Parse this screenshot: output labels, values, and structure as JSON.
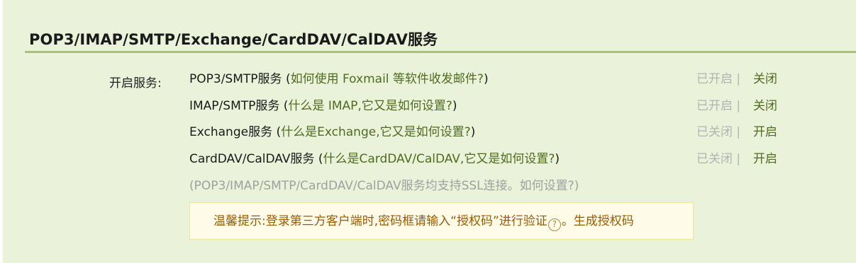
{
  "section": {
    "title": "POP3/IMAP/SMTP/Exchange/CardDAV/CalDAV服务"
  },
  "label": "开启服务:",
  "services": [
    {
      "name": "POP3/SMTP服务",
      "help": "如何使用 Foxmail 等软件收发邮件?",
      "status": "已开启 |",
      "action": "关闭"
    },
    {
      "name": "IMAP/SMTP服务",
      "help": "什么是 IMAP,它又是如何设置?",
      "status": "已开启 |",
      "action": "关闭"
    },
    {
      "name": "Exchange服务",
      "help": "什么是Exchange,它又是如何设置?",
      "status": "已关闭 |",
      "action": "开启"
    },
    {
      "name": "CardDAV/CalDAV服务",
      "help": "什么是CardDAV/CalDAV,它又是如何设置?",
      "status": "已关闭 |",
      "action": "开启"
    }
  ],
  "ssl_note": {
    "text": "(POP3/IMAP/SMTP/CardDAV/CalDAV服务均支持SSL连接。",
    "link": "如何设置?",
    "close_paren": ")"
  },
  "tip": {
    "text": "温馨提示:登录第三方客户端时,密码框请输入“授权码”进行验证",
    "icon": "help-circle-icon",
    "icon_glyph": "?",
    "after_icon": "。",
    "link": "生成授权码"
  }
}
